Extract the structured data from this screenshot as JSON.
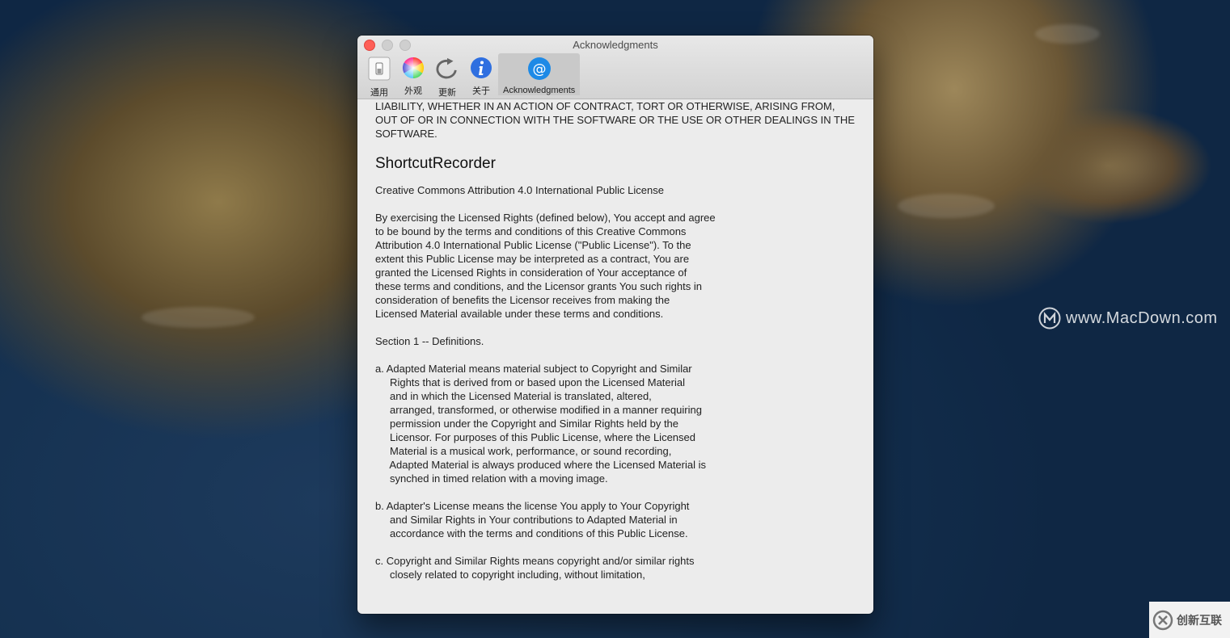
{
  "window": {
    "title": "Acknowledgments"
  },
  "toolbar": {
    "items": [
      {
        "label": "通用",
        "icon": "switch-icon"
      },
      {
        "label": "外观",
        "icon": "color-wheel-icon"
      },
      {
        "label": "更新",
        "icon": "refresh-icon"
      },
      {
        "label": "关于",
        "icon": "info-icon"
      },
      {
        "label": "Acknowledgments",
        "icon": "at-sign-icon",
        "active": true
      }
    ]
  },
  "content": {
    "top_fragment": "LIABILITY, WHETHER IN AN ACTION OF CONTRACT, TORT OR OTHERWISE, ARISING FROM,\nOUT OF OR IN CONNECTION WITH THE SOFTWARE OR THE USE OR OTHER DEALINGS IN THE\nSOFTWARE.",
    "section_title": "ShortcutRecorder",
    "paragraphs": [
      "Creative Commons Attribution 4.0 International Public License",
      "By exercising the Licensed Rights (defined below), You accept and agree\nto be bound by the terms and conditions of this Creative Commons\nAttribution 4.0 International Public License (\"Public License\"). To the\nextent this Public License may be interpreted as a contract, You are\ngranted the Licensed Rights in consideration of Your acceptance of\nthese terms and conditions, and the Licensor grants You such rights in\nconsideration of benefits the Licensor receives from making the\nLicensed Material available under these terms and conditions.",
      "Section 1 -- Definitions.",
      "a. Adapted Material means material subject to Copyright and Similar\n     Rights that is derived from or based upon the Licensed Material\n     and in which the Licensed Material is translated, altered,\n     arranged, transformed, or otherwise modified in a manner requiring\n     permission under the Copyright and Similar Rights held by the\n     Licensor. For purposes of this Public License, where the Licensed\n     Material is a musical work, performance, or sound recording,\n     Adapted Material is always produced where the Licensed Material is\n     synched in timed relation with a moving image.",
      "b. Adapter's License means the license You apply to Your Copyright\n     and Similar Rights in Your contributions to Adapted Material in\n     accordance with the terms and conditions of this Public License.",
      "c. Copyright and Similar Rights means copyright and/or similar rights\n     closely related to copyright including, without limitation,"
    ]
  },
  "watermark": {
    "text": "www.MacDown.com"
  },
  "corner_logo": {
    "text": "创新互联"
  },
  "colors": {
    "close": "#fe5f57",
    "accent": "#1e8ae6"
  }
}
